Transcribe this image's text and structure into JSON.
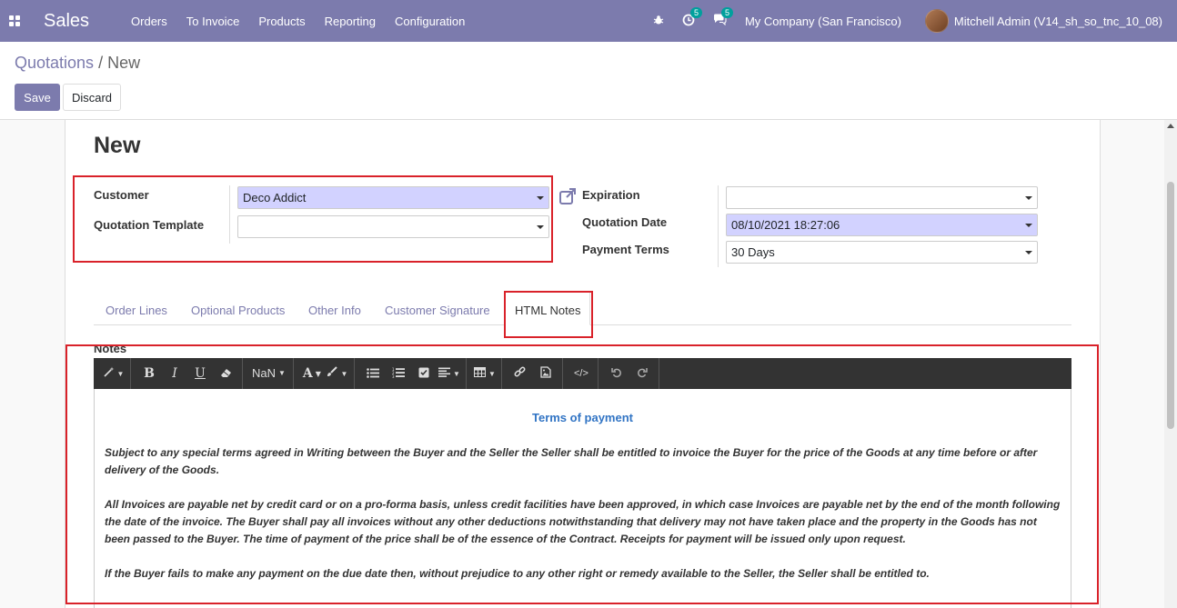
{
  "nav": {
    "brand": "Sales",
    "menu": [
      "Orders",
      "To Invoice",
      "Products",
      "Reporting",
      "Configuration"
    ],
    "activity_count": "5",
    "message_count": "5",
    "company": "My Company (San Francisco)",
    "user": "Mitchell Admin (V14_sh_so_tnc_10_08)"
  },
  "breadcrumb": {
    "parent": "Quotations",
    "separator": "/",
    "current": "New"
  },
  "buttons": {
    "save": "Save",
    "discard": "Discard"
  },
  "form": {
    "title": "New",
    "customer_label": "Customer",
    "customer_value": "Deco Addict",
    "template_label": "Quotation Template",
    "template_value": "",
    "expiration_label": "Expiration",
    "expiration_value": "",
    "quotation_date_label": "Quotation Date",
    "quotation_date_value": "08/10/2021 18:27:06",
    "payment_terms_label": "Payment Terms",
    "payment_terms_value": "30 Days"
  },
  "tabs": [
    "Order Lines",
    "Optional Products",
    "Other Info",
    "Customer Signature",
    "HTML Notes"
  ],
  "active_tab": "HTML Notes",
  "notes": {
    "label": "Notes",
    "toolbar_font_size": "NaN",
    "heading": "Terms of payment",
    "paragraphs": [
      "Subject to any special terms agreed in Writing between the Buyer and the Seller the Seller shall be entitled to invoice the Buyer for the price of the Goods at any time before or after delivery of the Goods.",
      "All Invoices are payable net by credit card or on a pro-forma basis, unless credit facilities have been approved, in which case Invoices are payable net by the end of the month following the date of the invoice. The Buyer shall pay all invoices without any other deductions notwithstanding that delivery may not have taken place and the property in the Goods has not been passed to the Buyer. The time of payment of the price shall be of the essence of the Contract. Receipts for payment will be issued only upon request.",
      "If the Buyer fails to make any payment on the due date then, without prejudice to any other right or remedy available to the Seller, the Seller shall be entitled to."
    ]
  },
  "colors": {
    "navbar": "#7c7bad",
    "highlight_box": "#d9222a",
    "required_field": "#d2d2ff",
    "notes_heading": "#3174c4"
  }
}
